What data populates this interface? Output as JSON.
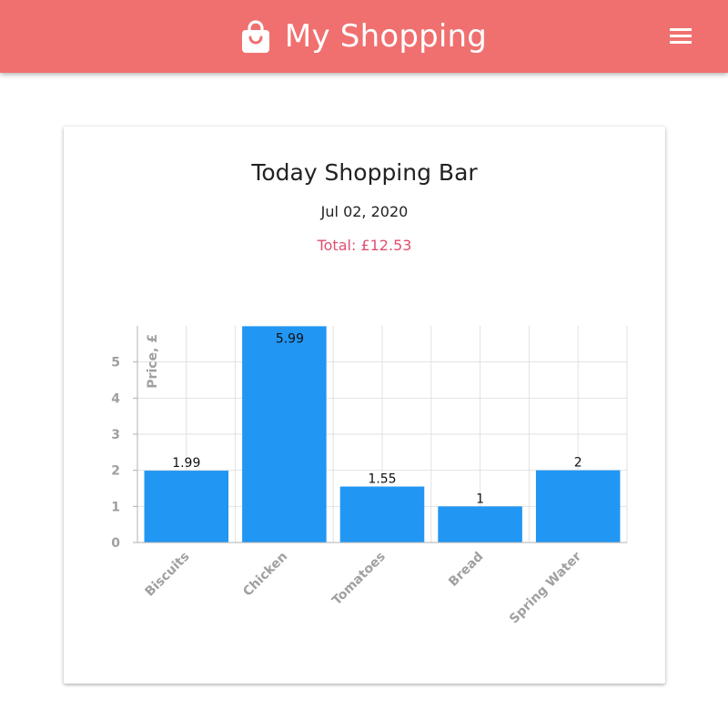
{
  "header": {
    "title": "My Shopping",
    "brand_icon": "shopping-bag-icon",
    "menu_icon": "hamburger-menu-icon",
    "bar_color": "#f07070"
  },
  "card": {
    "title": "Today Shopping Bar",
    "date": "Jul 02, 2020",
    "total_label": "Total:",
    "total_value": "£12.53",
    "total_color": "#e0506e"
  },
  "chart_data": {
    "type": "bar",
    "title": "",
    "categories": [
      "Biscuits",
      "Chicken",
      "Tomatoes",
      "Bread",
      "Spring Water"
    ],
    "values": [
      1.99,
      5.99,
      1.55,
      1,
      2
    ],
    "data_labels": [
      "1.99",
      "5.99",
      "1.55",
      "1",
      "2"
    ],
    "xlabel": "",
    "ylabel": "Price, £",
    "ylim": [
      0,
      6
    ],
    "yticks": [
      0,
      1,
      2,
      3,
      4,
      5
    ],
    "grid": true,
    "bar_color": "#2196f3"
  }
}
